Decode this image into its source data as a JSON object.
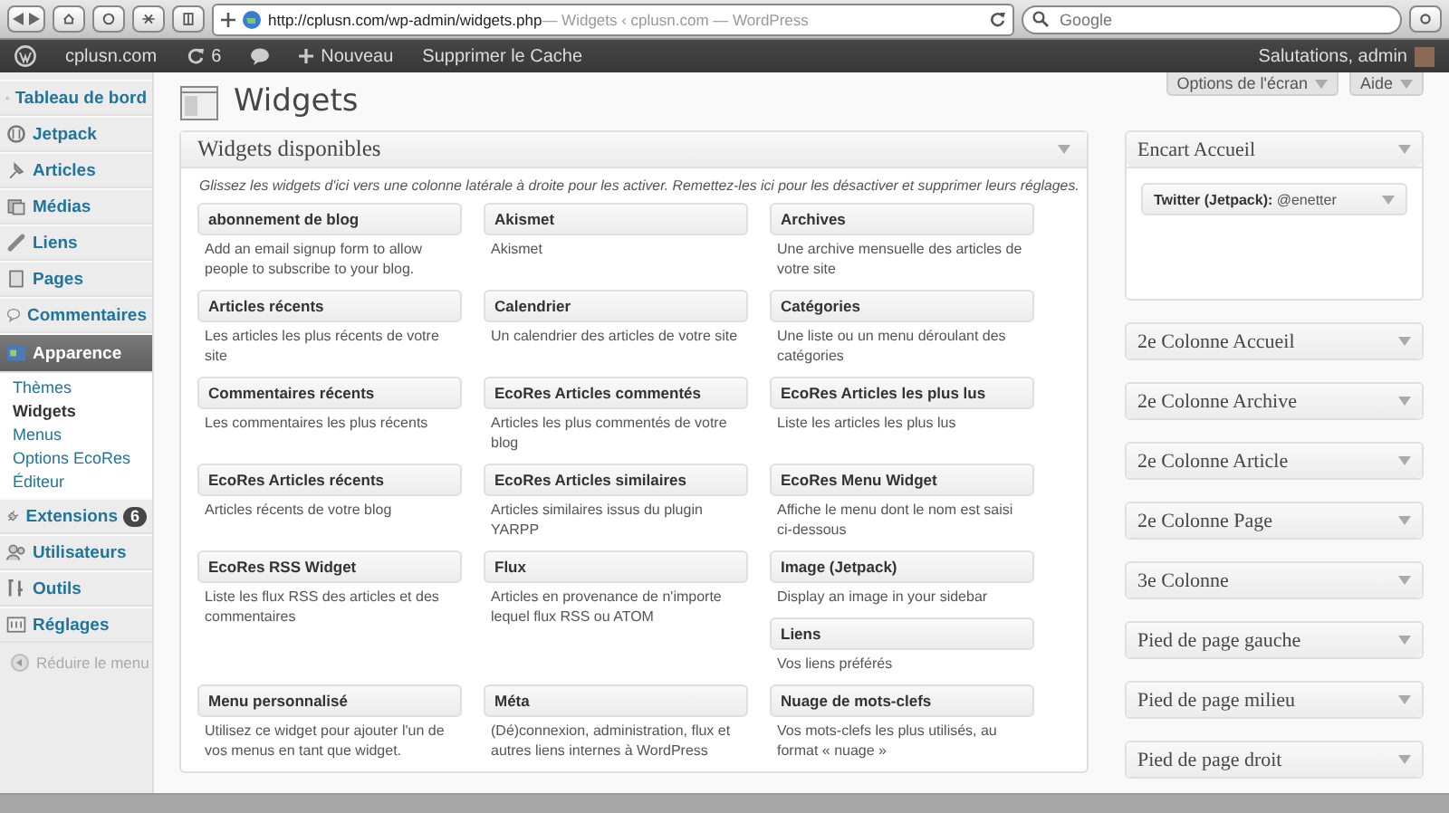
{
  "browser": {
    "url": "http://cplusn.com/wp-admin/widgets.php",
    "page_title": " — Widgets ‹ cplusn.com — WordPress",
    "search_placeholder": "Google"
  },
  "admin_bar": {
    "site": "cplusn.com",
    "updates": "6",
    "new": "Nouveau",
    "cache": "Supprimer le Cache",
    "greeting": "Salutations, admin"
  },
  "sidebar": {
    "items": [
      {
        "label": "Tableau de bord",
        "selected": false
      },
      {
        "label": "Jetpack",
        "selected": false
      },
      {
        "label": "Articles",
        "selected": false
      },
      {
        "label": "Médias",
        "selected": false
      },
      {
        "label": "Liens",
        "selected": false
      },
      {
        "label": "Pages",
        "selected": false
      },
      {
        "label": "Commentaires",
        "selected": false
      },
      {
        "label": "Apparence",
        "selected": true,
        "children": [
          {
            "label": "Thèmes",
            "selected": false
          },
          {
            "label": "Widgets",
            "selected": true
          },
          {
            "label": "Menus",
            "selected": false
          },
          {
            "label": "Options EcoRes",
            "selected": false
          },
          {
            "label": "Éditeur",
            "selected": false
          }
        ]
      },
      {
        "label": "Extensions",
        "selected": false,
        "badge": "6"
      },
      {
        "label": "Utilisateurs",
        "selected": false
      },
      {
        "label": "Outils",
        "selected": false
      },
      {
        "label": "Réglages",
        "selected": false
      }
    ],
    "collapse": "Réduire le menu"
  },
  "page_title": "Widgets",
  "screen_options": "Options de l'écran",
  "help": "Aide",
  "available": {
    "title": "Widgets disponibles",
    "description": "Glissez les widgets d'ici vers une colonne latérale à droite pour les activer. Remettez-les ici pour les désactiver et supprimer leurs réglages.",
    "rows": [
      [
        [
          {
            "name": "abonnement de blog",
            "description": "Add an email signup form to allow people to subscribe to your blog."
          }
        ],
        [
          {
            "name": "Akismet",
            "description": "Akismet"
          }
        ],
        [
          {
            "name": "Archives",
            "description": "Une archive mensuelle des articles de votre site"
          }
        ]
      ],
      [
        [
          {
            "name": "Articles récents",
            "description": "Les articles les plus récents de votre site"
          }
        ],
        [
          {
            "name": "Calendrier",
            "description": "Un calendrier des articles de votre site"
          }
        ],
        [
          {
            "name": "Catégories",
            "description": "Une liste ou un menu déroulant des catégories"
          }
        ]
      ],
      [
        [
          {
            "name": "Commentaires récents",
            "description": "Les commentaires les plus récents"
          }
        ],
        [
          {
            "name": "EcoRes Articles commentés",
            "description": "Articles les plus commentés de votre blog"
          }
        ],
        [
          {
            "name": "EcoRes Articles les plus lus",
            "description": "Liste les articles les plus lus"
          }
        ]
      ],
      [
        [
          {
            "name": "EcoRes Articles récents",
            "description": "Articles récents de votre blog"
          }
        ],
        [
          {
            "name": "EcoRes Articles similaires",
            "description": "Articles similaires issus du plugin YARPP"
          }
        ],
        [
          {
            "name": "EcoRes Menu Widget",
            "description": "Affiche le menu dont le nom est saisi ci-dessous"
          }
        ]
      ],
      [
        [
          {
            "name": "EcoRes RSS Widget",
            "description": "Liste les flux RSS des articles et des commentaires"
          }
        ],
        [
          {
            "name": "Flux",
            "description": "Articles en provenance de n'importe lequel flux RSS ou ATOM"
          }
        ],
        [
          {
            "name": "Image (Jetpack)",
            "description": "Display an image in your sidebar"
          },
          {
            "name": "Liens",
            "description": "Vos liens préférés"
          }
        ]
      ],
      [
        [
          {
            "name": "Menu personnalisé",
            "description": "Utilisez ce widget pour ajouter l'un de vos menus en tant que widget."
          }
        ],
        [
          {
            "name": "Méta",
            "description": "(Dé)connexion, administration, flux et autres liens internes à WordPress"
          }
        ],
        [
          {
            "name": "Nuage de mots-clefs",
            "description": "Vos mots-clefs les plus utilisés, au format « nuage »"
          }
        ]
      ]
    ]
  },
  "sidebars": [
    {
      "title": "Encart Accueil",
      "expanded": true,
      "widgets": [
        "**Twitter (Jetpack):** @enetter"
      ]
    },
    {
      "title": "2e Colonne Accueil",
      "expanded": false
    },
    {
      "title": "2e Colonne Archive",
      "expanded": false
    },
    {
      "title": "2e Colonne Article",
      "expanded": false
    },
    {
      "title": "2e Colonne Page",
      "expanded": false
    },
    {
      "title": "3e Colonne",
      "expanded": false
    },
    {
      "title": "Pied de page gauche",
      "expanded": false
    },
    {
      "title": "Pied de page milieu",
      "expanded": false
    },
    {
      "title": "Pied de page droit",
      "expanded": false
    }
  ]
}
